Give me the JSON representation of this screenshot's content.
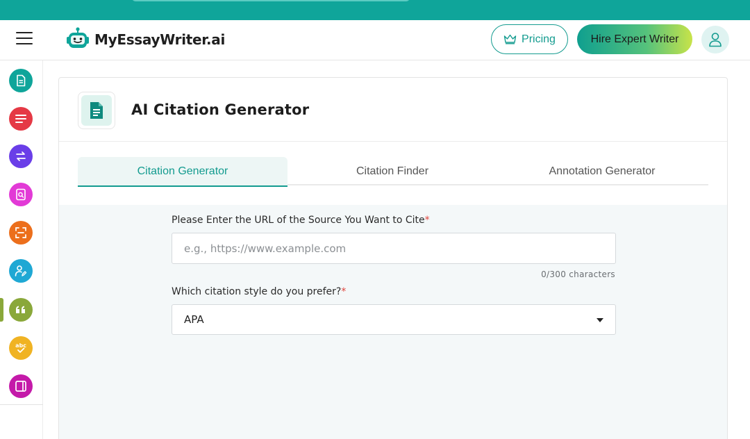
{
  "header": {
    "logo_text": "MyEssayWriter.ai",
    "pricing_label": "Pricing",
    "hire_label": "Hire Expert Writer"
  },
  "sidebar": {
    "items": [
      {
        "icon": "document-icon",
        "color": "#0fa59a"
      },
      {
        "icon": "text-lines-icon",
        "color": "#e53945"
      },
      {
        "icon": "paraphrase-icon",
        "color": "#6a3ee8"
      },
      {
        "icon": "document-search-icon",
        "color": "#e23ad6"
      },
      {
        "icon": "scan-icon",
        "color": "#ec6f1c"
      },
      {
        "icon": "user-edit-icon",
        "color": "#1fa8d4"
      },
      {
        "icon": "quote-icon",
        "color": "#8aa83a",
        "active": true
      },
      {
        "icon": "grammar-check-icon",
        "color": "#f0b323"
      },
      {
        "icon": "book-icon",
        "color": "#c41aa9"
      }
    ]
  },
  "page": {
    "title": "AI Citation Generator"
  },
  "tabs": [
    {
      "label": "Citation Generator",
      "active": true
    },
    {
      "label": "Citation Finder",
      "active": false
    },
    {
      "label": "Annotation Generator",
      "active": false
    }
  ],
  "form": {
    "url_label": "Please Enter the URL of the Source You Want to Cite",
    "url_placeholder": "e.g., https://www.example.com",
    "url_value": "",
    "counter": "0/300 characters",
    "style_label": "Which citation style do you prefer?",
    "style_value": "APA",
    "required_mark": "*"
  },
  "colors": {
    "brand": "#0fa59a",
    "required": "#e0443c"
  }
}
